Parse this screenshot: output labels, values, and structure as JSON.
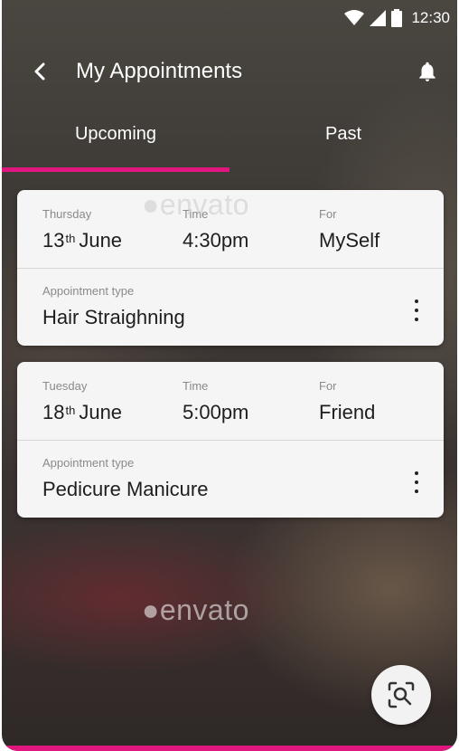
{
  "status_bar": {
    "time": "12:30"
  },
  "app_bar": {
    "title": "My Appointments"
  },
  "tabs": [
    {
      "label": "Upcoming",
      "selected": true
    },
    {
      "label": "Past",
      "selected": false
    }
  ],
  "appointments": [
    {
      "day_label": "Thursday",
      "date_num": "13",
      "date_suffix": "th",
      "date_month": "June",
      "time_label": "Time",
      "time": "4:30pm",
      "for_label": "For",
      "for_value": "MySelf",
      "type_label": "Appointment type",
      "type_value": "Hair Straighning"
    },
    {
      "day_label": "Tuesday",
      "date_num": "18",
      "date_suffix": "th",
      "date_month": "June",
      "time_label": "Time",
      "time": "5:00pm",
      "for_label": "For",
      "for_value": "Friend",
      "type_label": "Appointment type",
      "type_value": "Pedicure Manicure"
    }
  ],
  "watermark": "envato",
  "colors": {
    "accent": "#e0177f",
    "card": "#f5f5f5",
    "text_dark": "#1e1e1e",
    "label_gray": "#8a8a8a"
  },
  "icons": [
    "wifi-icon",
    "cellular-signal-icon",
    "battery-icon",
    "back-arrow-icon",
    "bell-icon",
    "more-vert-icon",
    "image-search-icon"
  ]
}
